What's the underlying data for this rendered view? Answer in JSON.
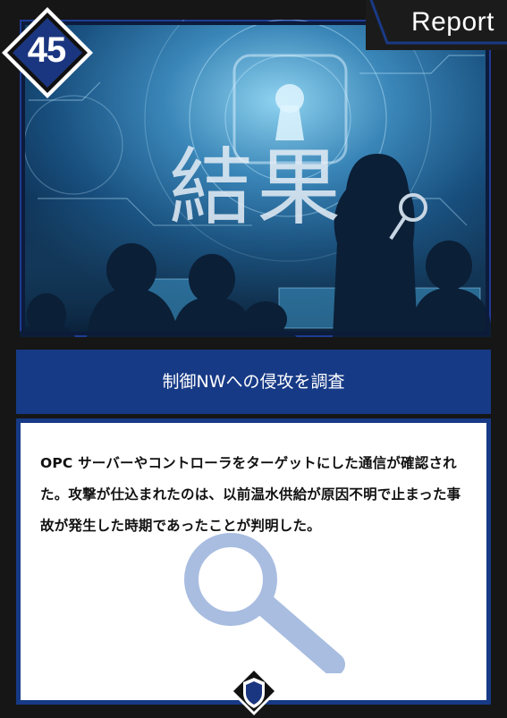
{
  "card": {
    "number": "45",
    "category": "Report",
    "image_caption": "結果",
    "title": "制御NWへの侵攻を調査",
    "description": "OPC サーバーやコントローラをターゲットにした通信が確認された。攻撃が仕込まれたのは、以前温水供給が原因不明で止まった事故が発生した時期であったことが判明した。",
    "icons": {
      "watermark": "magnifier-icon",
      "footer": "shield-icon"
    },
    "colors": {
      "frame": "#161616",
      "accent": "#173a86",
      "badge": "#1b3680",
      "panel_background": "#ffffff",
      "watermark": "#a8bde0"
    }
  }
}
